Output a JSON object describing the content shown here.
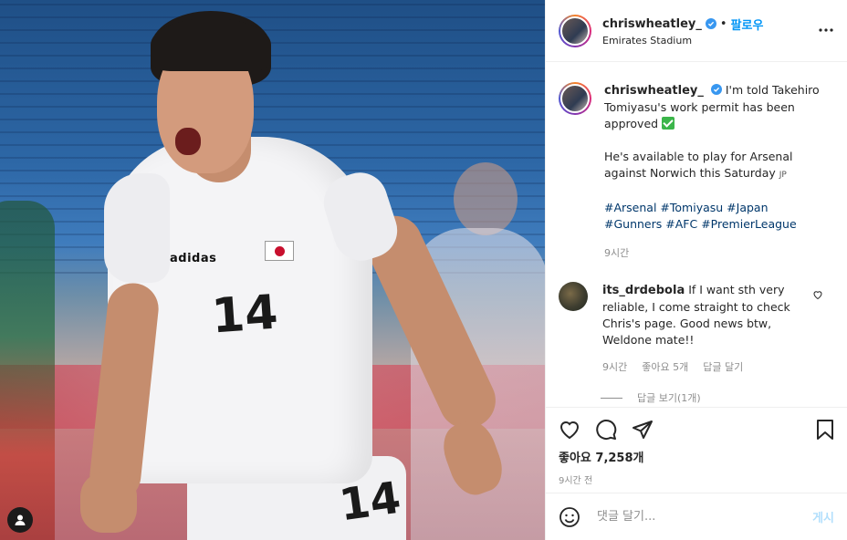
{
  "post": {
    "username": "chriswheatley_",
    "follow_label": "팔로우",
    "separator": "•",
    "location": "Emirates Stadium",
    "photo": {
      "shirt_number": "14",
      "shorts_number": "14",
      "brand": "adidas"
    }
  },
  "caption": {
    "username": "chriswheatley_",
    "line1": "I'm told Takehiro Tomiyasu's work permit has been approved",
    "line2": "He's available to play for Arsenal against Norwich this Saturday",
    "flag_suffix": "JP",
    "hashtags": [
      "#Arsenal",
      "#Tomiyasu",
      "#Japan",
      "#Gunners",
      "#AFC",
      "#PremierLeague"
    ],
    "time": "9시간"
  },
  "comment": {
    "username": "its_drdebola",
    "text": "If I want sth very reliable, I come straight to check Chris's page. Good news btw, Weldone mate!!",
    "time": "9시간",
    "likes": "좋아요 5개",
    "reply": "답글 달기",
    "view_replies": "답글 보기(1개)"
  },
  "stats": {
    "likes": "좋아요 7,258개",
    "posted": "9시간 전"
  },
  "composer": {
    "placeholder": "댓글 달기...",
    "post_label": "게시"
  },
  "colors": {
    "accent": "#0095f6",
    "hashtag": "#00376b",
    "muted": "#8e8e8e",
    "verified": "#3897f0",
    "check": "#3bb54a"
  }
}
